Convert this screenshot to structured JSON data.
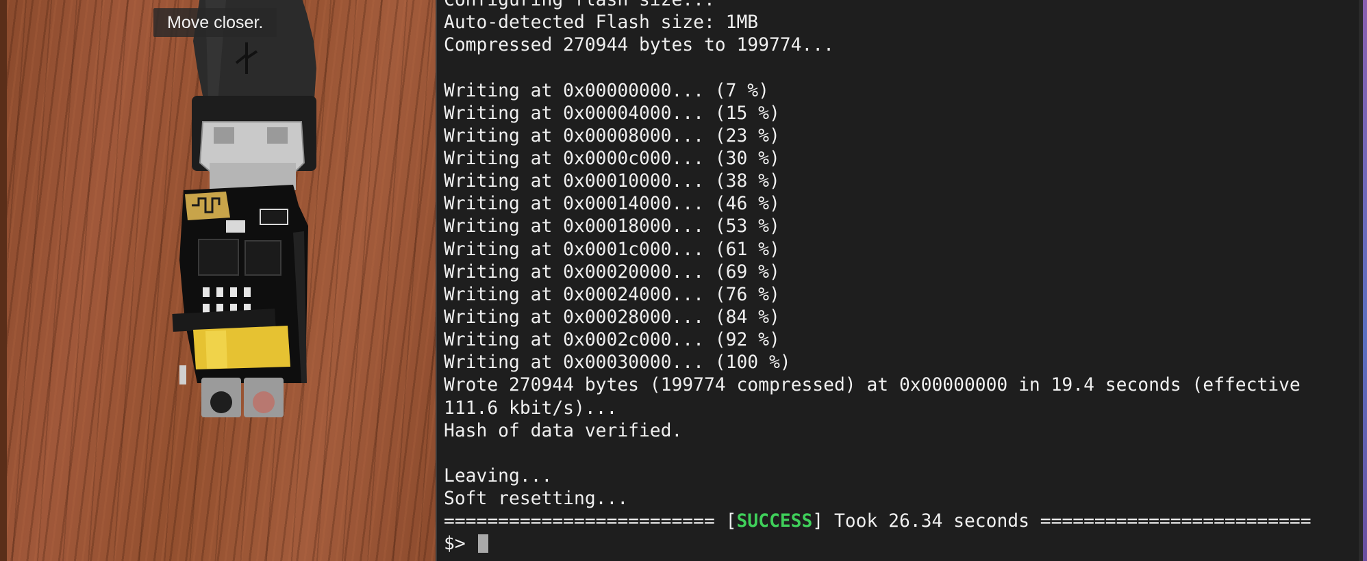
{
  "camera": {
    "hint": "Move closer."
  },
  "terminal": {
    "lines": [
      "Configuring flash size...",
      "Auto-detected Flash size: 1MB",
      "Compressed 270944 bytes to 199774...",
      "",
      "Writing at 0x00000000... (7 %)",
      "Writing at 0x00004000... (15 %)",
      "Writing at 0x00008000... (23 %)",
      "Writing at 0x0000c000... (30 %)",
      "Writing at 0x00010000... (38 %)",
      "Writing at 0x00014000... (46 %)",
      "Writing at 0x00018000... (53 %)",
      "Writing at 0x0001c000... (61 %)",
      "Writing at 0x00020000... (69 %)",
      "Writing at 0x00024000... (76 %)",
      "Writing at 0x00028000... (84 %)",
      "Writing at 0x0002c000... (92 %)",
      "Writing at 0x00030000... (100 %)",
      "Wrote 270944 bytes (199774 compressed) at 0x00000000 in 19.4 seconds (effective",
      "111.6 kbit/s)...",
      "Hash of data verified.",
      "",
      "Leaving...",
      "Soft resetting..."
    ],
    "status_line": {
      "prefix": "========================= [",
      "status": "SUCCESS",
      "suffix": "] Took 26.34 seconds =========================",
      "status_color": "#3fcf5a"
    },
    "prompt": "$> "
  }
}
